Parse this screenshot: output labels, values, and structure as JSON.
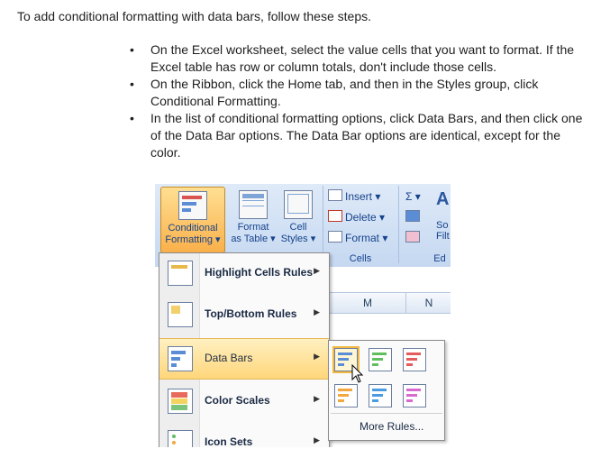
{
  "intro": "To add conditional formatting with data bars, follow these steps.",
  "steps": [
    "On the Excel worksheet, select the value cells that you want to format. If the Excel table has row or column totals, don't include those cells.",
    "On the Ribbon, click the Home tab, and then in the Styles group, click Conditional Formatting.",
    "In the list of conditional formatting options, click Data Bars, and then click one of the Data Bar options. The Data Bar options are identical, except for the color."
  ],
  "ribbon": {
    "conditional_formatting": [
      "Conditional",
      "Formatting ▾"
    ],
    "format_as_table": [
      "Format",
      "as Table ▾"
    ],
    "cell_styles": [
      "Cell",
      "Styles ▾"
    ],
    "insert": "Insert ▾",
    "delete": "Delete ▾",
    "format": "Format ▾",
    "cells_group": "Cells",
    "sort_partial": [
      "So",
      "Filt"
    ],
    "editing_partial": "Ed",
    "sum_symbol": "Σ ▾"
  },
  "columns": [
    "M",
    "N"
  ],
  "menu": {
    "items": [
      {
        "label": "Highlight Cells Rules",
        "icon": "highlight-cells-icon"
      },
      {
        "label": "Top/Bottom Rules",
        "icon": "top-bottom-icon"
      },
      {
        "label": "Data Bars",
        "icon": "data-bars-icon"
      },
      {
        "label": "Color Scales",
        "icon": "color-scales-icon"
      },
      {
        "label": "Icon Sets",
        "icon": "icon-sets-icon"
      }
    ],
    "arrow": "▶"
  },
  "submenu": {
    "more_rules": "More Rules...",
    "bar_colors": [
      "#5b8dd6",
      "#5fbf5f",
      "#e45b5b",
      "#f4a640",
      "#4a9be0",
      "#d66ad0"
    ]
  }
}
